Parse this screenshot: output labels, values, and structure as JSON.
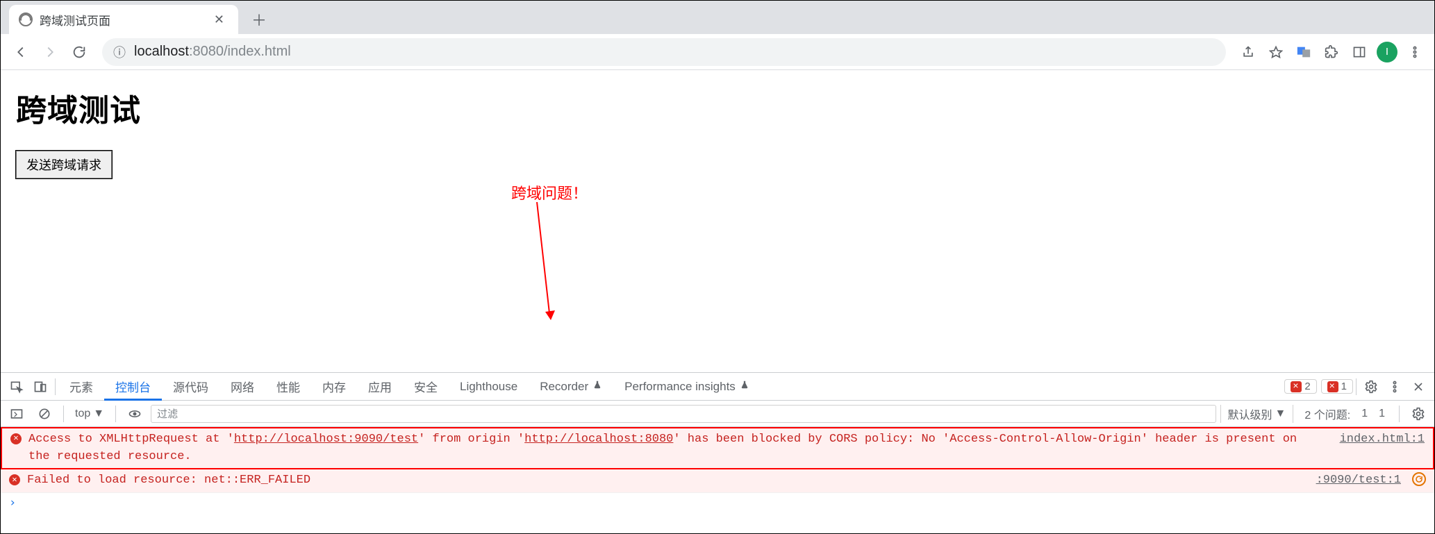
{
  "window": {
    "tab_title": "跨域测试页面"
  },
  "toolbar": {
    "url_host": "localhost",
    "url_port_path": ":8080/index.html"
  },
  "avatar_initial": "I",
  "page": {
    "heading": "跨域测试",
    "button_label": "发送跨域请求",
    "annotation_text": "跨域问题！"
  },
  "devtools": {
    "tabs": [
      "元素",
      "控制台",
      "源代码",
      "网络",
      "性能",
      "内存",
      "应用",
      "安全",
      "Lighthouse",
      "Recorder",
      "Performance insights"
    ],
    "active_tab_index": 1,
    "error_badge_count": "2",
    "issue_badge_count": "1",
    "console_toolbar": {
      "context_label": "top",
      "filter_placeholder": "过滤",
      "level_label": "默认级别",
      "issues_label": "2 个问题:",
      "issues_err_count": "1",
      "issues_msg_count": "1"
    },
    "console_rows": [
      {
        "type": "error",
        "boxed": true,
        "msg_parts": [
          {
            "t": "Access to XMLHttpRequest at '"
          },
          {
            "t": "http://localhost:9090/test",
            "ul": true
          },
          {
            "t": "' from origin '"
          },
          {
            "t": "http://localhost:8080",
            "ul": true
          },
          {
            "t": "' has been blocked by CORS policy: No 'Access-Control-Allow-Origin' header is present on the requested resource."
          }
        ],
        "source": "index.html:1",
        "repeat": false
      },
      {
        "type": "error",
        "boxed": false,
        "msg_parts": [
          {
            "t": "Failed to load resource: net::ERR_FAILED"
          }
        ],
        "source": ":9090/test:1",
        "repeat": true
      }
    ]
  }
}
